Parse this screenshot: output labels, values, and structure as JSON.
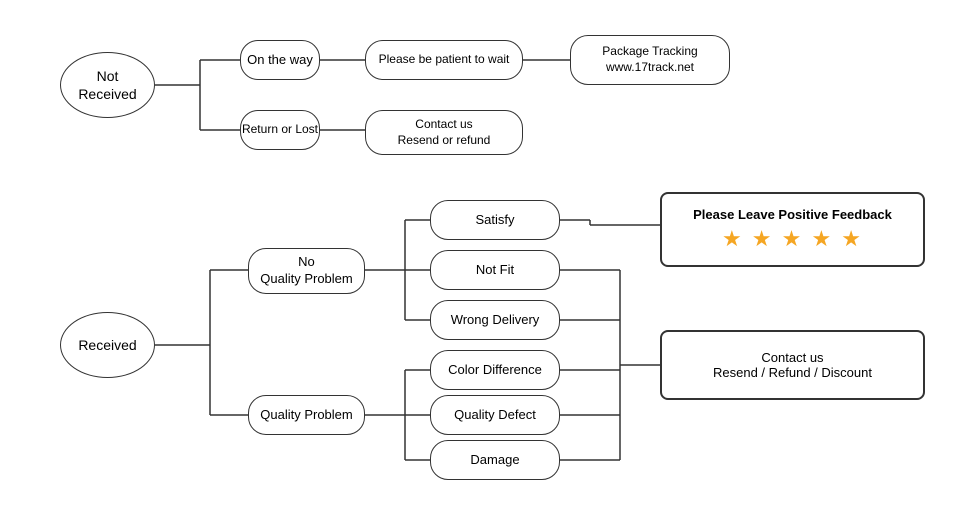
{
  "nodes": {
    "not_received": {
      "label": "Not\nReceived"
    },
    "on_the_way": {
      "label": "On the way"
    },
    "return_or_lost": {
      "label": "Return or Lost"
    },
    "be_patient": {
      "label": "Please be patient to wait"
    },
    "contact_resend": {
      "label": "Contact us\nResend or refund"
    },
    "package_tracking": {
      "label": "Package Tracking\nwww.17track.net"
    },
    "received": {
      "label": "Received"
    },
    "no_quality": {
      "label": "No\nQuality Problem"
    },
    "quality_problem": {
      "label": "Quality Problem"
    },
    "satisfy": {
      "label": "Satisfy"
    },
    "not_fit": {
      "label": "Not Fit"
    },
    "wrong_delivery": {
      "label": "Wrong Delivery"
    },
    "color_difference": {
      "label": "Color Difference"
    },
    "quality_defect": {
      "label": "Quality Defect"
    },
    "damage": {
      "label": "Damage"
    },
    "feedback": {
      "label": "Please Leave Positive Feedback"
    },
    "feedback_stars": {
      "label": "★ ★ ★ ★ ★"
    },
    "contact_us2": {
      "label": "Contact us\nResend / Refund / Discount"
    }
  }
}
